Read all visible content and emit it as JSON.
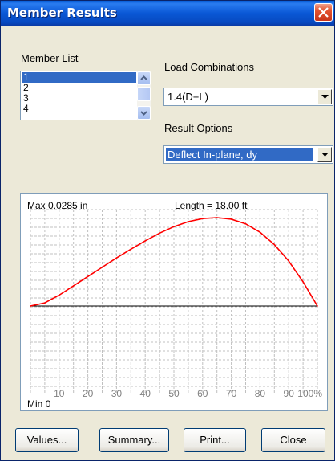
{
  "window": {
    "title": "Member Results"
  },
  "member_list": {
    "label": "Member List",
    "items": [
      "1",
      "2",
      "3",
      "4"
    ],
    "selected_index": 0
  },
  "load_combinations": {
    "label": "Load Combinations",
    "value": "1.4(D+L)"
  },
  "result_options": {
    "label": "Result Options",
    "value": "Deflect In-plane, dy"
  },
  "chart_data": {
    "type": "line",
    "max_label": "Max 0.0285 in",
    "min_label": "Min 0",
    "length_label": "Length = 18.00 ft",
    "x_tick_labels": [
      "10",
      "20",
      "30",
      "40",
      "50",
      "60",
      "70",
      "80",
      "90",
      "100%"
    ],
    "x": [
      0,
      5,
      10,
      15,
      20,
      25,
      30,
      35,
      40,
      45,
      50,
      55,
      60,
      65,
      70,
      75,
      80,
      85,
      90,
      95,
      100
    ],
    "y": [
      0,
      0.001,
      0.0035,
      0.0065,
      0.0095,
      0.0125,
      0.0155,
      0.0183,
      0.021,
      0.0235,
      0.0256,
      0.0272,
      0.0282,
      0.0285,
      0.028,
      0.0265,
      0.0238,
      0.0198,
      0.0145,
      0.0078,
      0
    ],
    "ylim": [
      -0.0285,
      0.0285
    ],
    "line_color": "#ff0000",
    "grid": true
  },
  "buttons": {
    "values": "Values...",
    "summary": "Summary...",
    "print": "Print...",
    "close": "Close"
  }
}
